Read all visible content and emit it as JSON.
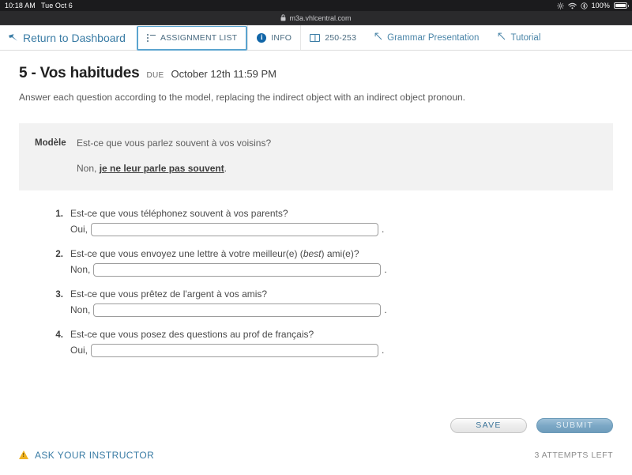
{
  "status_bar": {
    "time": "10:18 AM",
    "date": "Tue Oct 6",
    "battery_percent": "100%",
    "icons": [
      "brightness-icon",
      "wifi-icon",
      "bluetooth-icon",
      "battery-icon"
    ]
  },
  "browser": {
    "url": "m3a.vhlcentral.com",
    "lock_icon": "lock-icon"
  },
  "topnav": {
    "return_label": "Return to Dashboard",
    "return_icon": "back-arrow-icon",
    "tabs": [
      {
        "label": "ASSIGNMENT LIST",
        "icon": "list-icon",
        "active": true
      },
      {
        "label": "INFO",
        "icon": "info-circle-icon",
        "active": false
      },
      {
        "label": "250-253",
        "icon": "book-icon",
        "active": false
      }
    ],
    "links": [
      {
        "label": "Grammar Presentation",
        "icon": "external-link-arrow-icon"
      },
      {
        "label": "Tutorial",
        "icon": "external-link-arrow-icon"
      }
    ]
  },
  "assignment": {
    "title": "5 - Vos habitudes",
    "due_label": "DUE",
    "due_date": "October 12th 11:59 PM",
    "instructions": "Answer each question according to the model, replacing the indirect object with an indirect object pronoun."
  },
  "modele": {
    "label": "Modèle",
    "question": "Est-ce que vous parlez souvent à vos voisins?",
    "answer_prefix": "Non, ",
    "answer_bold": "je ne leur parle pas souvent",
    "answer_suffix": "."
  },
  "questions": [
    {
      "number": "1.",
      "text_before": "Est-ce que vous téléphonez souvent à vos parents?",
      "italic": "",
      "text_after": "",
      "prefix": "Oui,",
      "value": "",
      "period": "."
    },
    {
      "number": "2.",
      "text_before": "Est-ce que vous envoyez une lettre à votre meilleur(e) (",
      "italic": "best",
      "text_after": ") ami(e)?",
      "prefix": "Non,",
      "value": "",
      "period": "."
    },
    {
      "number": "3.",
      "text_before": "Est-ce que vous prêtez de l'argent à vos amis?",
      "italic": "",
      "text_after": "",
      "prefix": "Non,",
      "value": "",
      "period": "."
    },
    {
      "number": "4.",
      "text_before": "Est-ce que vous posez des questions au prof de français?",
      "italic": "",
      "text_after": "",
      "prefix": "Oui,",
      "value": "",
      "period": "."
    }
  ],
  "footer": {
    "save_label": "SAVE",
    "submit_label": "SUBMIT",
    "ask_instructor_label": "ASK YOUR INSTRUCTOR",
    "ask_instructor_icon": "warning-triangle-icon",
    "attempts_left": "3 ATTEMPTS LEFT"
  },
  "colors": {
    "accent_blue": "#3a7ca5",
    "tab_active_border": "#5ba4cf",
    "info_icon_blue": "#1166a8",
    "warning_yellow": "#f0b323",
    "modele_bg": "#f2f2f2",
    "submit_blue": "#7ca8c6"
  }
}
